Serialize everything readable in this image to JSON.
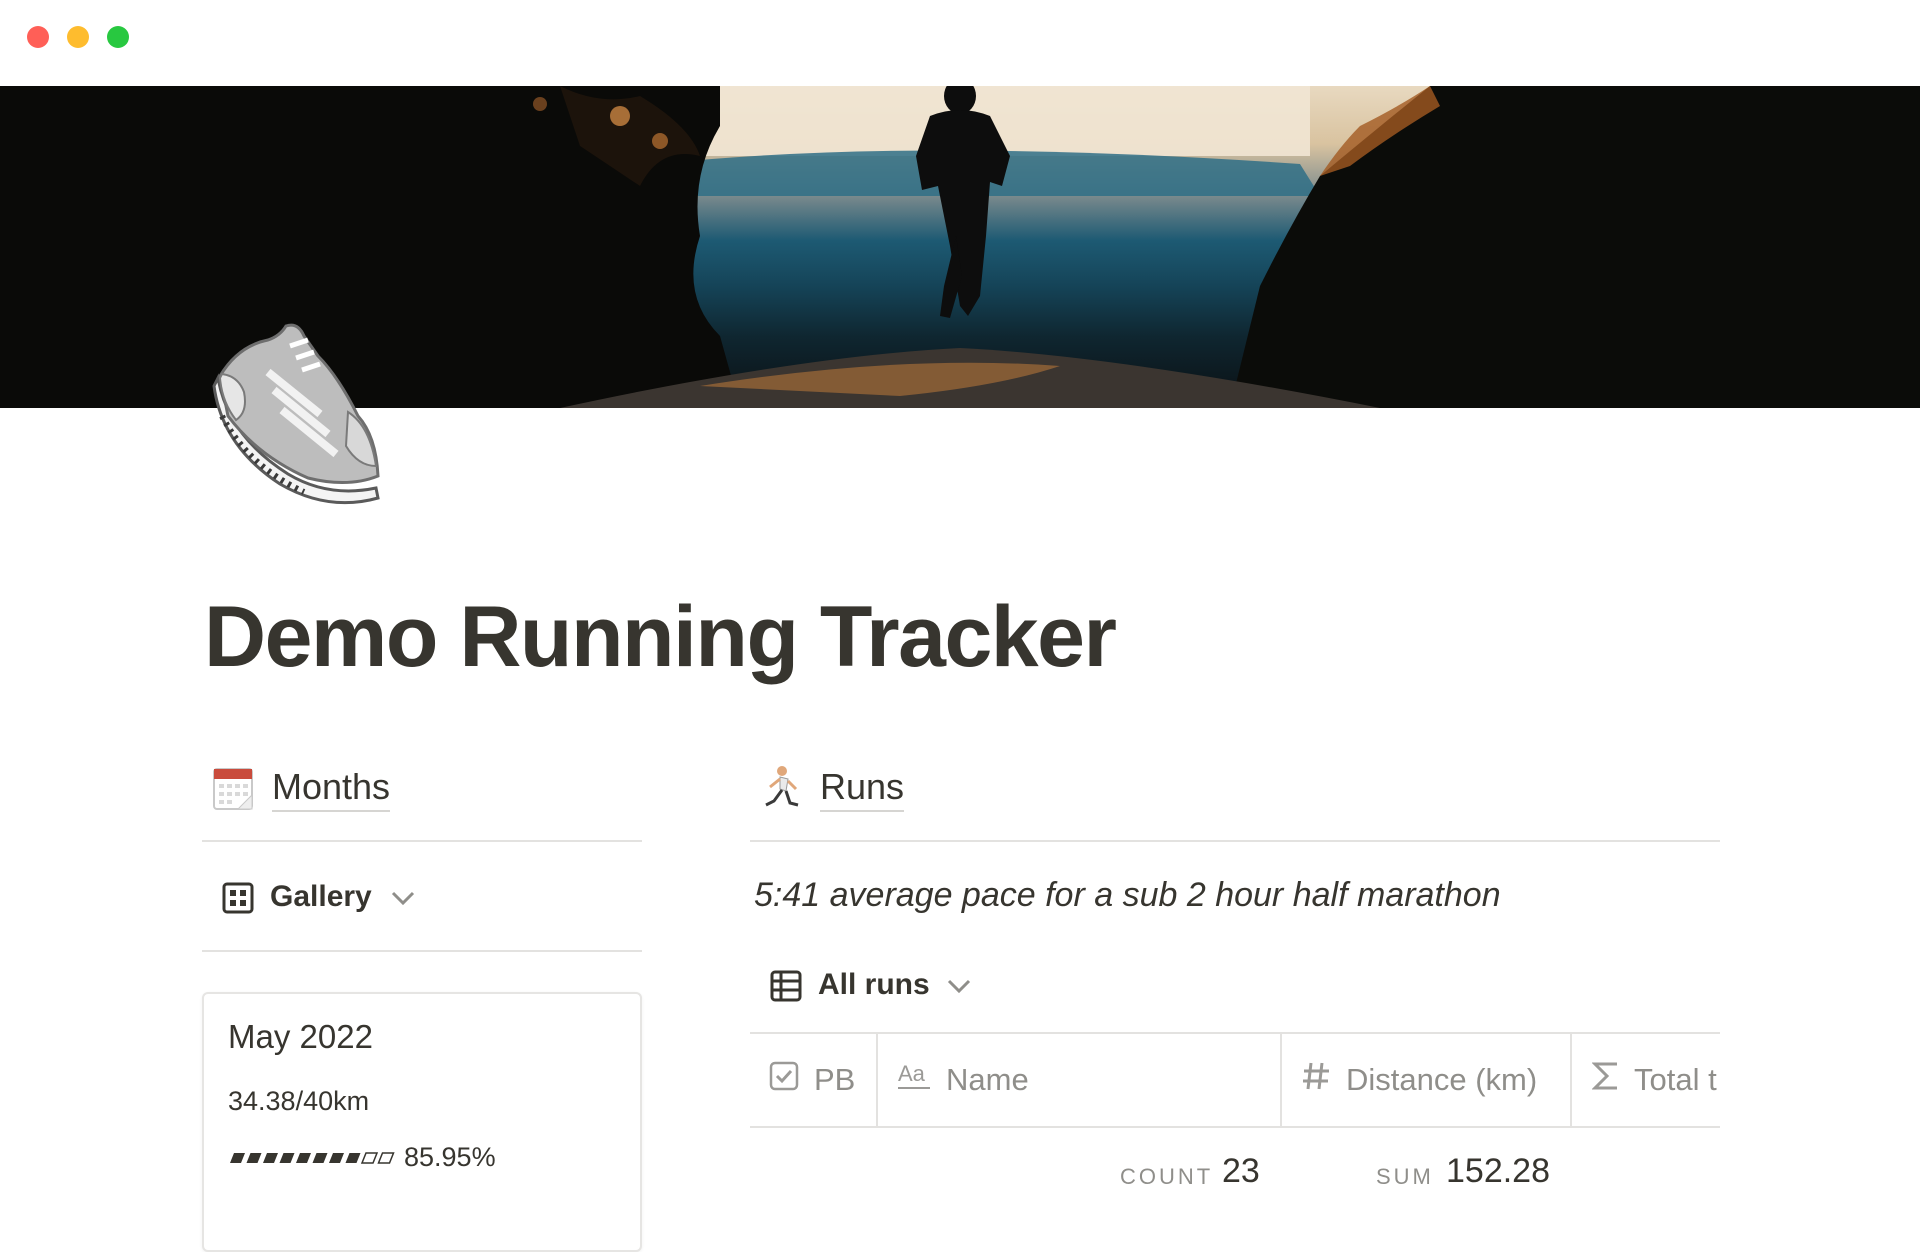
{
  "window": {
    "controls": [
      "close",
      "minimize",
      "zoom"
    ]
  },
  "cover": {
    "description_icon": "cover-photo"
  },
  "page": {
    "icon": "running-shoe-icon",
    "title": "Demo Running Tracker"
  },
  "months": {
    "heading": "Months",
    "heading_icon": "calendar-icon",
    "view": {
      "label": "Gallery",
      "icon": "gallery-icon"
    },
    "card": {
      "title": "May 2022",
      "distance": "34.38/40km",
      "progress_text": "85.95%",
      "progress_fraction": 0.8595
    }
  },
  "runs": {
    "heading": "Runs",
    "heading_icon": "runner-icon",
    "quote": "5:41 average pace for a sub 2 hour half marathon",
    "view": {
      "label": "All runs",
      "icon": "table-icon"
    },
    "columns": [
      {
        "label": "PB",
        "icon": "checkbox-icon"
      },
      {
        "label": "Name",
        "icon": "text-icon"
      },
      {
        "label": "Distance (km)",
        "icon": "number-icon"
      },
      {
        "label": "Total t",
        "icon": "sigma-icon"
      }
    ],
    "summary": {
      "count_label": "COUNT",
      "count_value": "23",
      "sum_label": "SUM",
      "sum_value": "152.28"
    }
  }
}
